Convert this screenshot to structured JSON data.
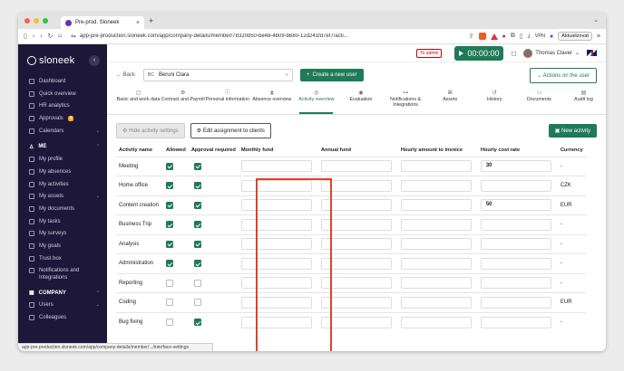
{
  "browser": {
    "tab_title": "Pre-prod. Sloneek",
    "url": "app-pre-production.sloneek.com/app/company-details/member/78320d50-be48-4b09-b680-12d241fd7ef7/acti...",
    "vpn_label": "VPN",
    "update_label": "Aktualizovat",
    "status_url": "app-pre-production.sloneek.com/app/company-details/member/.../interface-settings"
  },
  "sidebar": {
    "logo": "sloneek",
    "collapse_icon": "‹",
    "items": [
      {
        "label": "Dashboard"
      },
      {
        "label": "Quick overview"
      },
      {
        "label": "HR analytics"
      },
      {
        "label": "Approvals",
        "badge": "4"
      },
      {
        "label": "Calendars",
        "caret": "⌄"
      }
    ],
    "me_section": "ME",
    "me_items": [
      {
        "label": "My profile"
      },
      {
        "label": "My absences"
      },
      {
        "label": "My activities"
      },
      {
        "label": "My assets",
        "caret": "⌄"
      },
      {
        "label": "My documents"
      },
      {
        "label": "My tasks"
      },
      {
        "label": "My surveys"
      },
      {
        "label": "My goals"
      },
      {
        "label": "Trust box"
      },
      {
        "label": "Notifications and Integrations"
      }
    ],
    "company_section": "COMPANY",
    "company_items": [
      {
        "label": "Users",
        "caret": "⌄"
      },
      {
        "label": "Colleagues"
      }
    ]
  },
  "topbar": {
    "to_admin": "To admin",
    "timer": "00:00:00",
    "user_name": "Thomas Claver"
  },
  "search": {
    "back_label": "Back",
    "employee_initials": "BC",
    "employee_name": "Beruni Clara",
    "create_user": "Create a new user",
    "actions_user": "Actions on the user"
  },
  "tabs": [
    {
      "label": "Basic and work data",
      "icon": "▢"
    },
    {
      "label": "Contract and Payroll",
      "icon": "⚙"
    },
    {
      "label": "Personal information",
      "icon": "ⓘ"
    },
    {
      "label": "Absence overview",
      "icon": "⧗"
    },
    {
      "label": "Activity overview",
      "icon": "◎",
      "active": true
    },
    {
      "label": "Evaluation",
      "icon": "◉"
    },
    {
      "label": "Notifications & Integrations",
      "icon": "⊶"
    },
    {
      "label": "Assets",
      "icon": "⌘"
    },
    {
      "label": "History",
      "icon": "↺"
    },
    {
      "label": "Documents",
      "icon": "▭"
    },
    {
      "label": "Audit log",
      "icon": "▤"
    }
  ],
  "actions": {
    "hide_settings": "Hide activity settings",
    "edit_assignment": "Edit assignment to clients",
    "new_activity": "New activity"
  },
  "table": {
    "headers": [
      "Activity name",
      "Allowed",
      "Approval required",
      "Monthly fund",
      "Annual fund",
      "Hourly amount to invoice",
      "Hourly cost rate",
      "Currency"
    ],
    "rows": [
      {
        "name": "Meeting",
        "allowed": true,
        "approval": true,
        "rate": "30",
        "currency": "-"
      },
      {
        "name": "Home office",
        "allowed": true,
        "approval": true,
        "rate": "",
        "currency": "CZK"
      },
      {
        "name": "Content creation",
        "allowed": true,
        "approval": true,
        "rate": "50",
        "currency": "EUR"
      },
      {
        "name": "Business Trip",
        "allowed": true,
        "approval": true,
        "rate": "",
        "currency": "-"
      },
      {
        "name": "Analysis",
        "allowed": true,
        "approval": true,
        "rate": "",
        "currency": "-"
      },
      {
        "name": "Administration",
        "allowed": true,
        "approval": true,
        "rate": "",
        "currency": "-"
      },
      {
        "name": "Reporting",
        "allowed": false,
        "approval": false,
        "rate": "",
        "currency": "-"
      },
      {
        "name": "Coding",
        "allowed": false,
        "approval": false,
        "rate": "",
        "currency": "EUR"
      },
      {
        "name": "Bug fixing",
        "allowed": false,
        "approval": true,
        "rate": "",
        "currency": "-"
      }
    ]
  },
  "colors": {
    "accent": "#1f7a59",
    "sidebar": "#1d1739",
    "highlight": "#e0412b"
  }
}
